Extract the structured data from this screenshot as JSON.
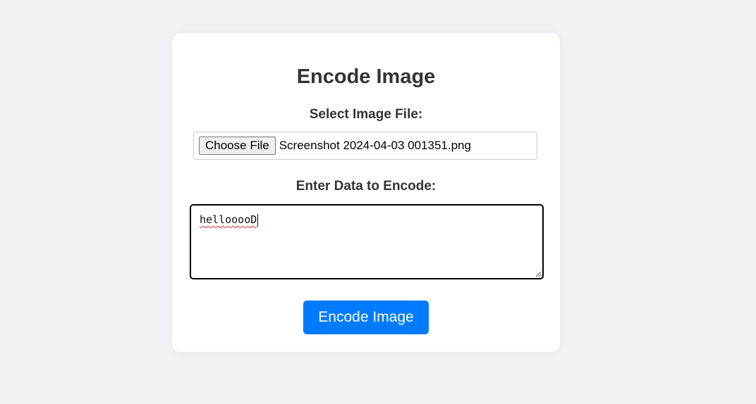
{
  "page": {
    "title": "Encode Image"
  },
  "file_section": {
    "label": "Select Image File:",
    "button_label": "Choose File",
    "selected_file": "Screenshot 2024-04-03 001351.png"
  },
  "data_section": {
    "label": "Enter Data to Encode:",
    "value": "hellooooD"
  },
  "submit": {
    "label": "Encode Image"
  },
  "colors": {
    "background": "#f0f2f5",
    "card": "#ffffff",
    "primary_button": "#007bff",
    "text": "#333333"
  },
  "icons": {
    "resize": "resize-grip-icon"
  }
}
